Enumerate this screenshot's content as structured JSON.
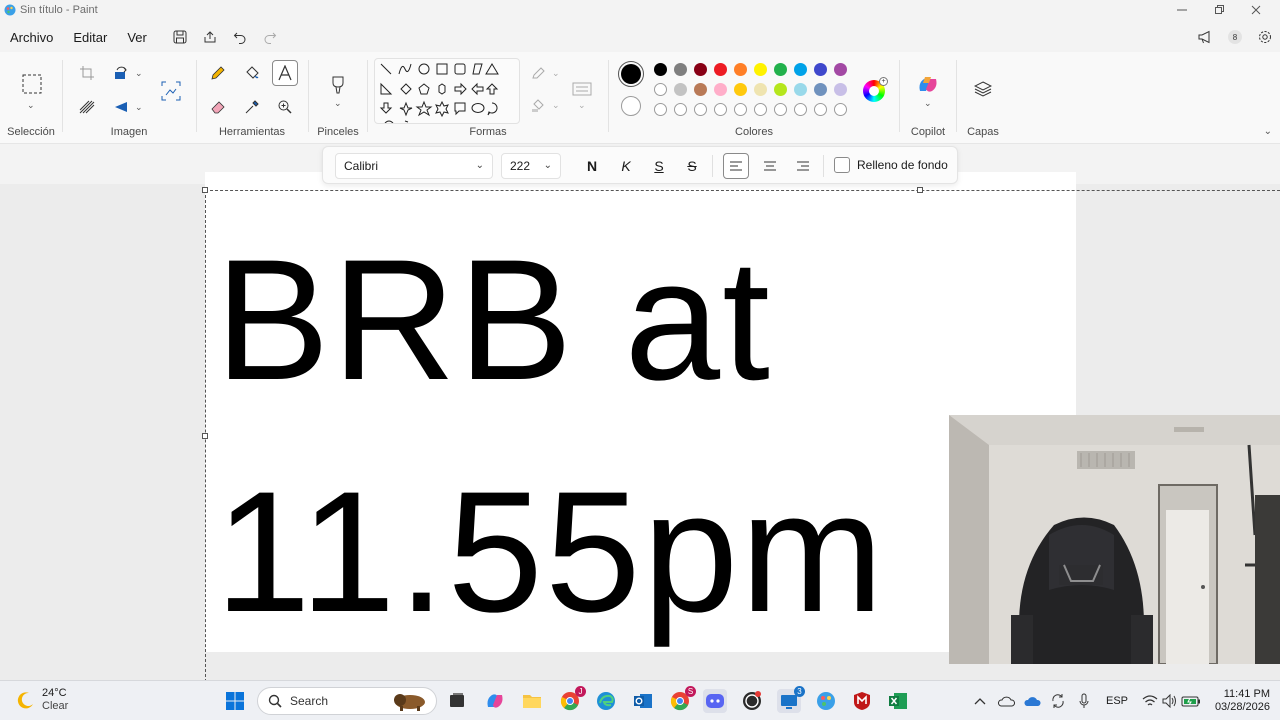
{
  "window": {
    "title": "Sin título - Paint"
  },
  "menu": {
    "items": [
      "Archivo",
      "Editar",
      "Ver"
    ],
    "notifications_count": "8"
  },
  "ribbon": {
    "groups": {
      "selection": "Selección",
      "image": "Imagen",
      "tools": "Herramientas",
      "brushes": "Pinceles",
      "shapes": "Formas",
      "colors": "Colores",
      "copilot": "Copilot",
      "layers": "Capas"
    },
    "palette_row1": [
      "#000000",
      "#7f7f7f",
      "#880015",
      "#ed1c24",
      "#ff7f27",
      "#fff200",
      "#22b14c",
      "#00a2e8",
      "#3f48cc",
      "#a349a4"
    ],
    "palette_row2": [
      "empty",
      "#c3c3c3",
      "#b97a57",
      "#ffaec9",
      "#ffc90e",
      "#efe4b0",
      "#b5e61d",
      "#99d9ea",
      "#7092be",
      "#c8bfe7"
    ],
    "primary_color": "#000000",
    "secondary_color": "#ffffff"
  },
  "text_toolbar": {
    "font_family": "Calibri",
    "font_size": "222",
    "bold_label": "N",
    "italic_label": "K",
    "underline_label": "S",
    "strike_label": "S",
    "fill_label": "Relleno de fondo",
    "fill_checked": false
  },
  "canvas": {
    "line1": "BRB at",
    "line2": "11.55pm"
  },
  "taskbar": {
    "weather_temp": "24°C",
    "weather_desc": "Clear",
    "search_placeholder": "Search",
    "language": "ESP",
    "time": "11:41 PM",
    "date": "03/28/2026",
    "badges": {
      "chrome1": "J",
      "chrome2": "S",
      "app3": "3"
    }
  }
}
